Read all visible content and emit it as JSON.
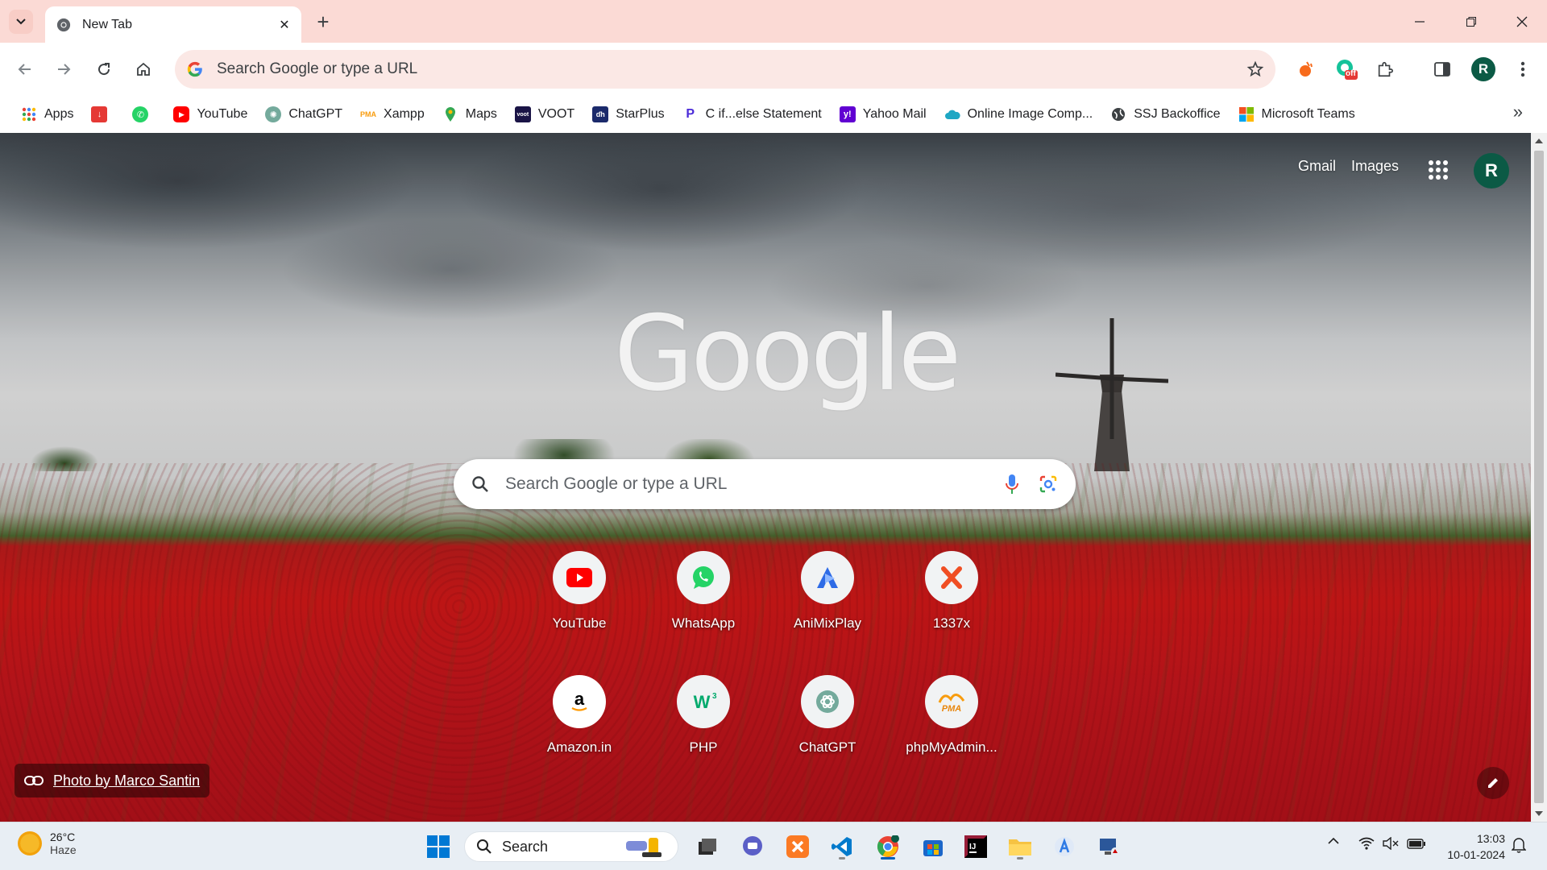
{
  "tab": {
    "title": "New Tab"
  },
  "omnibox": {
    "placeholder": "Search Google or type a URL"
  },
  "toolbar": {
    "profile_initial": "R",
    "extension_badge": "off"
  },
  "bookmarks": [
    {
      "label": "Apps",
      "icon": "apps-grid-icon",
      "color": "#ea4335"
    },
    {
      "label": "",
      "icon": "download-icon",
      "color": "#e53935"
    },
    {
      "label": "",
      "icon": "whatsapp-icon",
      "color": "#25d366"
    },
    {
      "label": "YouTube",
      "icon": "youtube-icon",
      "color": "#ff0000"
    },
    {
      "label": "ChatGPT",
      "icon": "chatgpt-icon",
      "color": "#10a37f"
    },
    {
      "label": "Xampp",
      "icon": "phpmyadmin-icon",
      "color": "#f89c0e"
    },
    {
      "label": "Maps",
      "icon": "maps-pin-icon",
      "color": "#34a853"
    },
    {
      "label": "VOOT",
      "icon": "voot-icon",
      "color": "#1a1446"
    },
    {
      "label": "StarPlus",
      "icon": "starplus-icon",
      "color": "#1b2a6b"
    },
    {
      "label": "C if...else Statement",
      "icon": "programiz-icon",
      "color": "#4b2bd8"
    },
    {
      "label": "Yahoo Mail",
      "icon": "yahoo-icon",
      "color": "#6001d2"
    },
    {
      "label": "Online Image Comp...",
      "icon": "cloud-icon",
      "color": "#1ea7c4"
    },
    {
      "label": "SSJ Backoffice",
      "icon": "globe-icon",
      "color": "#3c4043"
    },
    {
      "label": "Microsoft Teams",
      "icon": "microsoft-icon",
      "color": "#f25022"
    }
  ],
  "ntp": {
    "gmail": "Gmail",
    "images": "Images",
    "profile_initial": "R",
    "logo": "Google",
    "search_placeholder": "Search Google or type a URL",
    "photo_credit": "Photo by Marco Santin",
    "shortcuts": [
      {
        "label": "YouTube",
        "icon": "youtube-icon"
      },
      {
        "label": "WhatsApp",
        "icon": "whatsapp-icon"
      },
      {
        "label": "AniMixPlay",
        "icon": "animixplay-icon"
      },
      {
        "label": "1337x",
        "icon": "1337x-icon"
      },
      {
        "label": "Amazon.in",
        "icon": "amazon-icon"
      },
      {
        "label": "PHP",
        "icon": "w3schools-icon"
      },
      {
        "label": "ChatGPT",
        "icon": "chatgpt-icon"
      },
      {
        "label": "phpMyAdmin...",
        "icon": "phpmyadmin-icon"
      }
    ]
  },
  "taskbar": {
    "weather_temp": "26°C",
    "weather_condition": "Haze",
    "search_label": "Search",
    "time": "13:03",
    "date": "10-01-2024"
  }
}
